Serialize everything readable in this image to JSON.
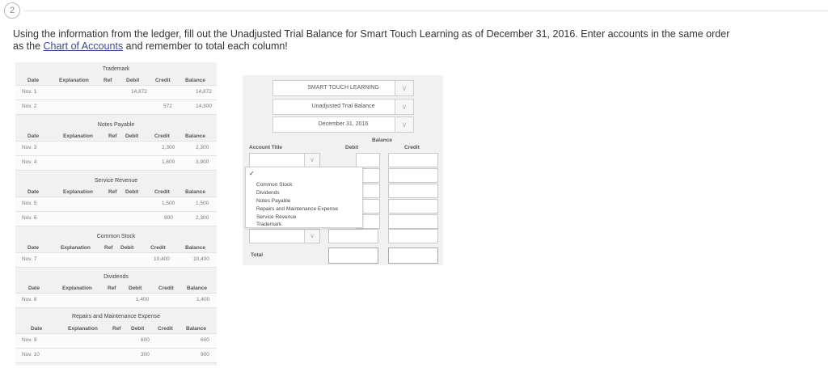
{
  "question": {
    "number": "2",
    "text_before_link": "Using the information from the ledger, fill out the Unadjusted Trial Balance for Smart Touch Learning as of December 31, 2016. Enter accounts in the same order as the ",
    "link": "Chart of Accounts",
    "text_after_link": " and remember to total each column!"
  },
  "ledger_headers": {
    "date": "Date",
    "explanation": "Explanation",
    "ref": "Ref",
    "debit": "Debit",
    "credit": "Credit",
    "balance": "Balance"
  },
  "ledger_accounts": [
    {
      "title": "Trademark",
      "rows": [
        {
          "date": "Nov. 1",
          "debit": "14,872",
          "credit": "",
          "balance": "14,872"
        },
        {
          "date": "Nov. 2",
          "debit": "",
          "credit": "572",
          "balance": "14,300"
        }
      ]
    },
    {
      "title": "Notes Payable",
      "rows": [
        {
          "date": "Nov. 3",
          "debit": "",
          "credit": "2,300",
          "balance": "2,300"
        },
        {
          "date": "Nov. 4",
          "debit": "",
          "credit": "1,600",
          "balance": "3,900"
        }
      ]
    },
    {
      "title": "Service Revenue",
      "rows": [
        {
          "date": "Nov. 5",
          "debit": "",
          "credit": "1,500",
          "balance": "1,500"
        },
        {
          "date": "Nov. 6",
          "debit": "",
          "credit": "800",
          "balance": "2,300"
        }
      ]
    },
    {
      "title": "Common Stock",
      "rows": [
        {
          "date": "Nov. 7",
          "debit": "",
          "credit": "10,400",
          "balance": "10,400"
        }
      ]
    },
    {
      "title": "Dividends",
      "rows": [
        {
          "date": "Nov. 8",
          "debit": "1,400",
          "credit": "",
          "balance": "1,400"
        }
      ]
    },
    {
      "title": "Repairs and Maintenance Expense",
      "rows": [
        {
          "date": "Nov. 9",
          "debit": "600",
          "credit": "",
          "balance": "600"
        },
        {
          "date": "Nov. 10",
          "debit": "300",
          "credit": "",
          "balance": "900"
        }
      ]
    }
  ],
  "trial_balance": {
    "company": "SMART TOUCH LEARNING",
    "report": "Unadjusted Trial Balance",
    "date": "December 31, 2016",
    "balance_label": "Balance",
    "account_title_label": "Account Title",
    "debit_label": "Debit",
    "credit_label": "Credit",
    "total_label": "Total",
    "dropdown_options": [
      "Common Stock",
      "Dividends",
      "Notes Payable",
      "Repairs and Maintenance Expense",
      "Service Revenue",
      "Trademark"
    ],
    "check_glyph": "✓",
    "arrow_glyph": "∨"
  }
}
